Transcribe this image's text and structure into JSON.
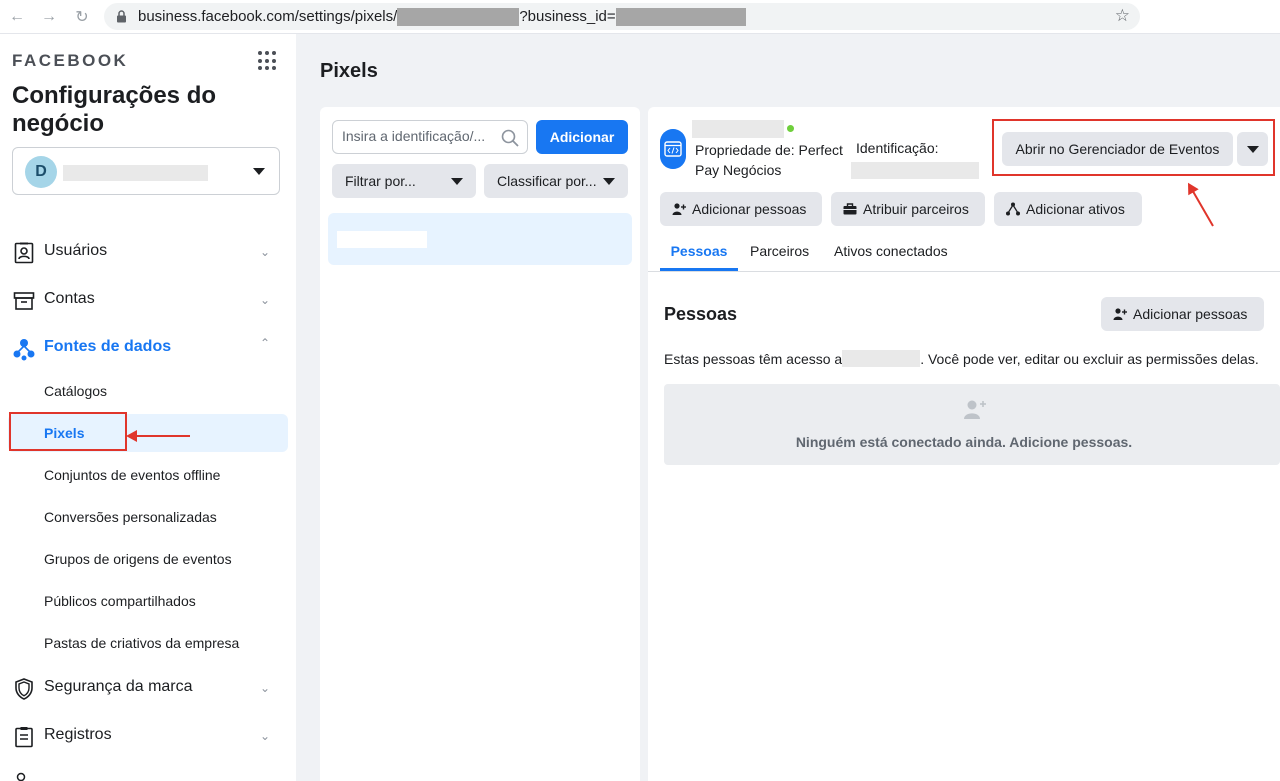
{
  "browser": {
    "url_prefix": "business.facebook.com/settings/pixels/",
    "url_middle": "?business_id="
  },
  "sidebar": {
    "logo": "FACEBOOK",
    "title": "Configurações do negócio",
    "business_avatar_letter": "D",
    "nav_items": [
      {
        "label": "Usuários"
      },
      {
        "label": "Contas"
      },
      {
        "label": "Fontes de dados"
      },
      {
        "label": "Segurança da marca"
      },
      {
        "label": "Registros"
      }
    ],
    "sub_items": [
      {
        "label": "Catálogos"
      },
      {
        "label": "Pixels"
      },
      {
        "label": "Conjuntos de eventos offline"
      },
      {
        "label": "Conversões personalizadas"
      },
      {
        "label": "Grupos de origens de eventos"
      },
      {
        "label": "Públicos compartilhados"
      },
      {
        "label": "Pastas de criativos da empresa"
      }
    ]
  },
  "main": {
    "page_title": "Pixels",
    "search_placeholder": "Insira a identificação/...",
    "add_button": "Adicionar",
    "filter_button": "Filtrar por...",
    "sort_button": "Classificar por..."
  },
  "detail": {
    "owner_label": "Propriedade de: Perfect Pay Negócios",
    "id_label": "Identificação:",
    "open_events_button": "Abrir no Gerenciador de Eventos",
    "actions": [
      {
        "label": "Adicionar pessoas",
        "icon": "add-person-icon"
      },
      {
        "label": "Atribuir parceiros",
        "icon": "briefcase-icon"
      },
      {
        "label": "Adicionar ativos",
        "icon": "share-icon"
      }
    ],
    "tabs": [
      {
        "label": "Pessoas"
      },
      {
        "label": "Parceiros"
      },
      {
        "label": "Ativos conectados"
      }
    ],
    "section_title": "Pessoas",
    "section_add_button": "Adicionar pessoas",
    "description_before": "Estas pessoas têm acesso a",
    "description_after": ". Você pode ver, editar ou excluir as permissões delas.",
    "empty_message": "Ninguém está conectado ainda. Adicione pessoas."
  },
  "colors": {
    "accent": "#1877f2",
    "annotation": "#e0352b",
    "status_online": "#6fcf3c"
  }
}
